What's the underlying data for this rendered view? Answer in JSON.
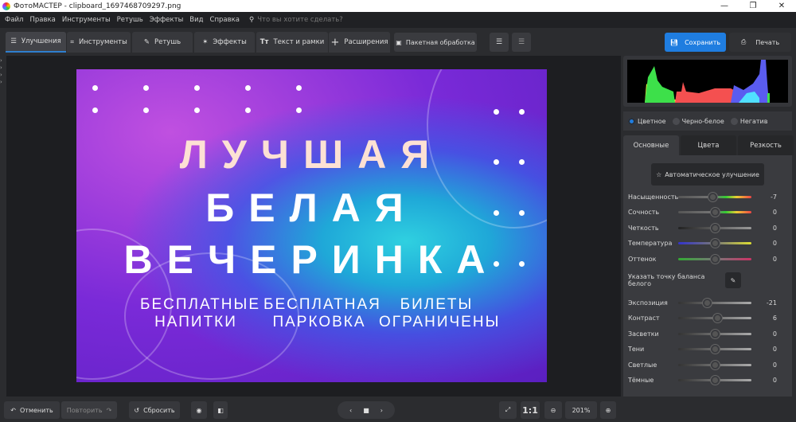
{
  "window": {
    "title": "ФотоМАСТЕР - clipboard_1697468709297.png"
  },
  "menu": {
    "items": [
      "Файл",
      "Правка",
      "Инструменты",
      "Ретушь",
      "Эффекты",
      "Вид",
      "Справка"
    ],
    "search_placeholder": "Что вы хотите сделать?"
  },
  "tabs": [
    "Улучшения",
    "Инструменты",
    "Ретушь",
    "Эффекты",
    "Текст и рамки",
    "Расширения"
  ],
  "toolbar": {
    "batch": "Пакетная обработка",
    "save": "Сохранить",
    "print": "Печать"
  },
  "colors": {
    "accent": "#1f7de0",
    "panel": "#3a3b3f"
  },
  "poster": {
    "line1": "ЛУЧШАЯ",
    "line2": "БЕЛАЯ",
    "line3": "ВЕЧЕРИНКА",
    "col1a": "БЕСПЛАТНЫЕ",
    "col1b": "НАПИТКИ",
    "col2a": "БЕСПЛАТНАЯ",
    "col2b": "ПАРКОВКА",
    "col3a": "БИЛЕТЫ",
    "col3b": "ОГРАНИЧЕНЫ"
  },
  "modes": {
    "items": [
      "Цветное",
      "Черно-белое",
      "Негатив"
    ],
    "selected": "Цветное"
  },
  "panel_tabs": {
    "items": [
      "Основные",
      "Цвета",
      "Резкость"
    ],
    "selected": "Основные"
  },
  "auto_button": "Автоматическое улучшение",
  "white_balance": "Указать точку баланса белого",
  "sliders1": [
    {
      "label": "Насыщенность",
      "value": "-7"
    },
    {
      "label": "Сочность",
      "value": "0"
    },
    {
      "label": "Четкость",
      "value": "0"
    },
    {
      "label": "Температура",
      "value": "0"
    },
    {
      "label": "Оттенок",
      "value": "0"
    }
  ],
  "sliders2": [
    {
      "label": "Экспозиция",
      "value": "-21"
    },
    {
      "label": "Контраст",
      "value": "6"
    },
    {
      "label": "Засветки",
      "value": "0"
    },
    {
      "label": "Тени",
      "value": "0"
    },
    {
      "label": "Светлые",
      "value": "0"
    },
    {
      "label": "Тёмные",
      "value": "0"
    }
  ],
  "bottom": {
    "undo": "Отменить",
    "redo": "Повторить",
    "reset": "Сбросить",
    "ratio": "1:1",
    "zoom": "201%"
  }
}
